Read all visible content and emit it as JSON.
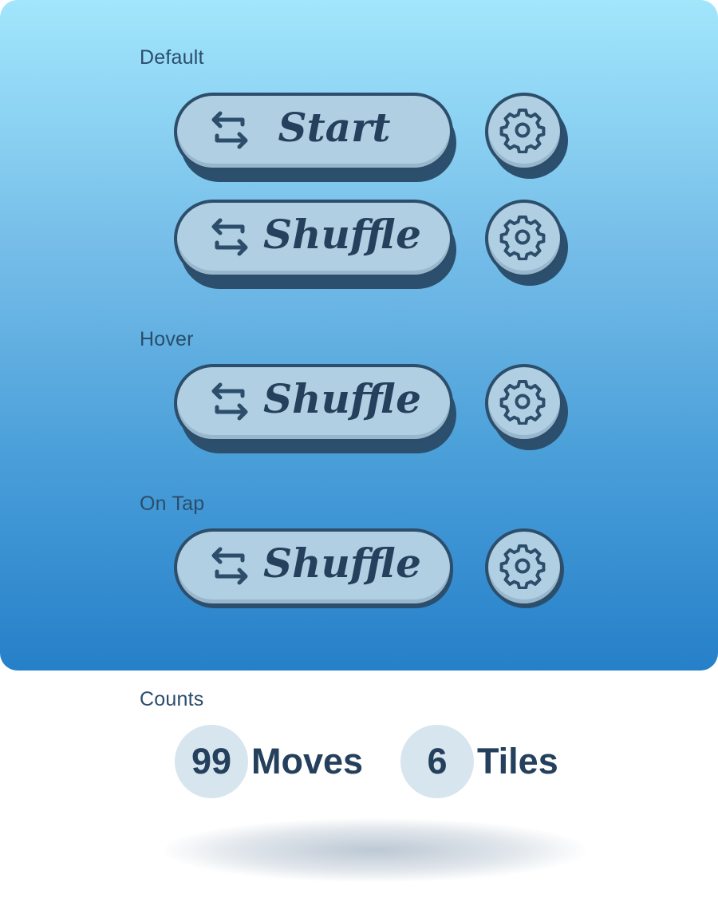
{
  "sections": {
    "default_label": "Default",
    "hover_label": "Hover",
    "tap_label": "On Tap",
    "counts_label": "Counts"
  },
  "buttons": {
    "start_label": "Start",
    "shuffle_label": "Shuffle"
  },
  "icons": {
    "swap": "swap-arrows-icon",
    "settings": "gear-icon"
  },
  "counts": {
    "moves": {
      "value": "99",
      "label": "Moves"
    },
    "tiles": {
      "value": "6",
      "label": "Tiles"
    }
  },
  "colors": {
    "panel_top": "#a2e6fc",
    "panel_bottom": "#2680c9",
    "button_face": "#b0cfe3",
    "button_outline": "#2c4e6b",
    "text_dark": "#24405c",
    "count_bubble": "#d7e5ee"
  }
}
